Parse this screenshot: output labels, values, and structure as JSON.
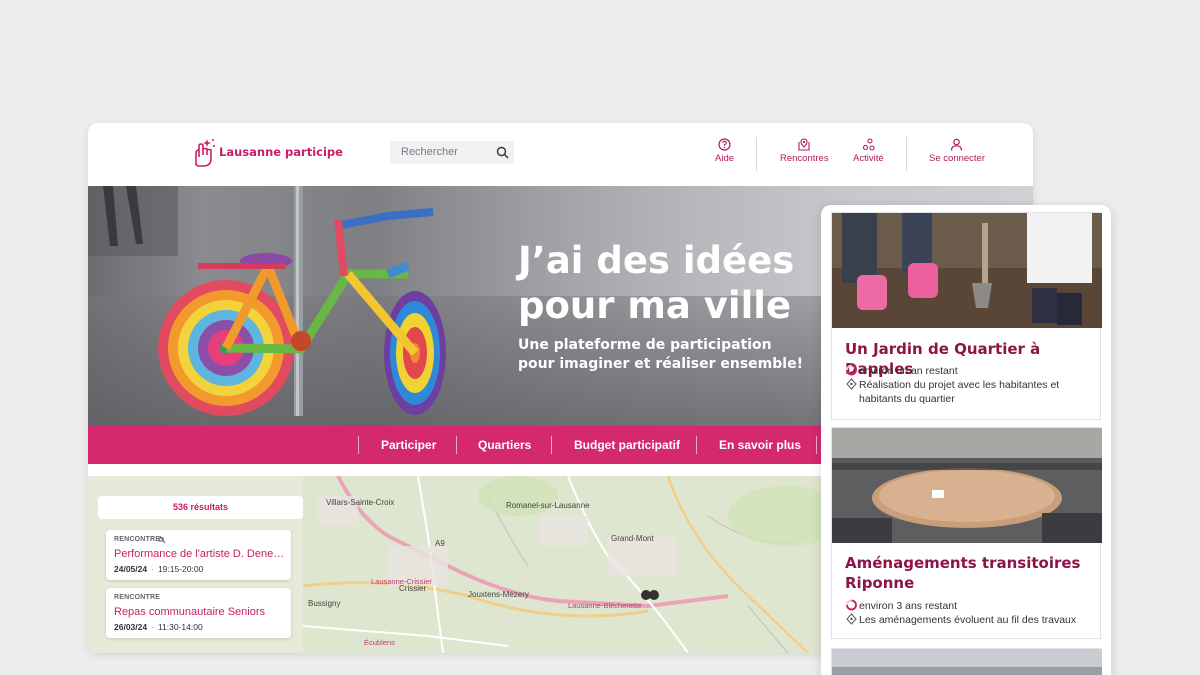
{
  "colors": {
    "brand": "#c81e66",
    "brand_dark": "#8c1446",
    "nav_bar": "#d4286f"
  },
  "header": {
    "logo_text": "Lausanne participe",
    "search": {
      "placeholder": "Rechercher"
    },
    "nav": {
      "help": "Aide",
      "meetings": "Rencontres",
      "activity": "Activité",
      "login": "Se connecter"
    }
  },
  "hero": {
    "title_line1": "J’ai des idées",
    "title_line2": "pour ma ville",
    "subtitle_line1": "Une plateforme de participation",
    "subtitle_line2": "pour imaginer et réaliser ensemble!"
  },
  "main_nav": {
    "participate": "Participer",
    "neighbourhoods": "Quartiers",
    "budget": "Budget participatif",
    "learn_more": "En savoir plus"
  },
  "map": {
    "labels": {
      "villars_croix": "Villars-Sainte-Croix",
      "romanel": "Romanel-sur-Lausanne",
      "grand_mont": "Grand-Mont",
      "crissier": "Crissier",
      "jouxtens": "Jouxtens-Mézery",
      "bussigny": "Bussigny",
      "lausanne_blecherette": "Lausanne-Blécherette",
      "lausanne_crissier": "Lausanne-Crissier",
      "a9": "A9",
      "ecublens": "Écublens"
    },
    "results": {
      "count": "536 résultats",
      "items": [
        {
          "type": "RENCONTRE",
          "title": "Performance de l'artiste D. Dene…",
          "date": "24/05/24",
          "time": "19:15-20:00"
        },
        {
          "type": "RENCONTRE",
          "title": "Repas communautaire Seniors",
          "date": "26/03/24",
          "time": "11:30-14:00"
        }
      ]
    }
  },
  "mobile": {
    "cards": [
      {
        "title": "Un Jardin de Quartier à Dapples",
        "remaining": "environ un an restant",
        "step_line1": "Réalisation du projet avec les habitantes et",
        "step_line2": "habitants du quartier"
      },
      {
        "title_line1": "Aménagements transitoires",
        "title_line2": "Riponne",
        "remaining": "environ 3 ans restant",
        "step_line1": "Les aménagements évoluent au fil des travaux"
      }
    ]
  }
}
